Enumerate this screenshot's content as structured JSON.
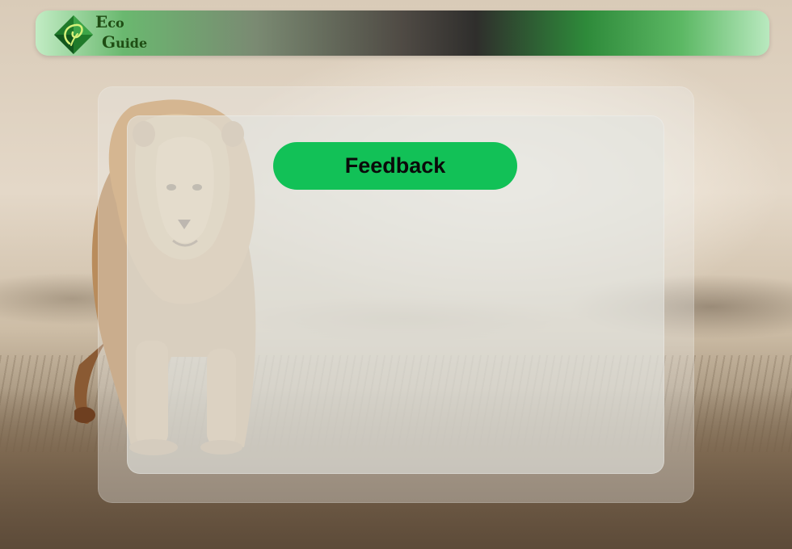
{
  "header": {
    "logo_line1_initial": "E",
    "logo_line1_rest": "co",
    "logo_line2_initial": "G",
    "logo_line2_rest": "uide",
    "logo_icon": "leaf-diamond-icon"
  },
  "main": {
    "feedback_label": "Feedback"
  },
  "background": {
    "scene": "lion-photo"
  },
  "colors": {
    "accent": "#12c157",
    "brand_dark": "#1f4d14"
  }
}
